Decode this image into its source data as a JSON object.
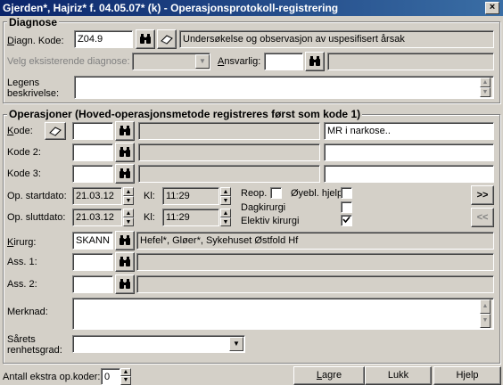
{
  "window": {
    "title": "Gjerden*, Hajriz* f. 04.05.07* (k) - Operasjonsprotokoll-registrering",
    "close": "×"
  },
  "diagnose": {
    "group_title": "Diagnose",
    "kode_label": "Diagn. Kode:",
    "kode_value": "Z04.9",
    "kode_desc": "Undersøkelse og observasjon av uspesifisert årsak",
    "velg_label": "Velg eksisterende diagnose:",
    "ansvarlig_label": "Ansvarlig:",
    "ansvarlig_value": "",
    "legens_label_1": "Legens",
    "legens_label_2": "beskrivelse:",
    "legens_value": ""
  },
  "operasjoner": {
    "group_title": "Operasjoner (Hoved-operasjonsmetode registreres først som kode 1)",
    "kode1_label": "Kode:",
    "kode1_value": "",
    "kode1_note": "MR i narkose..",
    "kode2_label": "Kode 2:",
    "kode3_label": "Kode 3:",
    "startdato_label": "Op. startdato:",
    "startdato_value": "21.03.12",
    "start_kl_label": "Kl:",
    "start_kl_value": "11:29",
    "sluttdato_label": "Op. sluttdato:",
    "sluttdato_value": "21.03.12",
    "slutt_kl_label": "Kl:",
    "slutt_kl_value": "11:29",
    "reop_label": "Reop.",
    "reop_checked": false,
    "oyebl_label": "Øyebl. hjelp",
    "oyebl_checked": false,
    "dagkirurgi_label": "Dagkirurgi",
    "dagkirurgi_checked": false,
    "elektiv_label": "Elektiv kirurgi",
    "elektiv_checked": true,
    "next_btn": ">>",
    "prev_btn": "<<",
    "kirurg_label": "Kirurg:",
    "kirurg_value": "SKANN",
    "kirurg_name": "Hefel*, Gløer*, Sykehuset Østfold Hf",
    "ass1_label": "Ass. 1:",
    "ass1_value": "",
    "ass2_label": "Ass. 2:",
    "ass2_value": "",
    "merknad_label": "Merknad:",
    "merknad_value": "",
    "sarets_label_1": "Sårets",
    "sarets_label_2": "renhetsgrad:",
    "sarets_value": ""
  },
  "footer": {
    "antall_label": "Antall ekstra op.koder:",
    "antall_value": "0",
    "lagre": "Lagre",
    "lukk": "Lukk",
    "hjelp": "Hjelp"
  },
  "icons": {
    "search": "binoculars-icon",
    "book": "book-icon"
  }
}
